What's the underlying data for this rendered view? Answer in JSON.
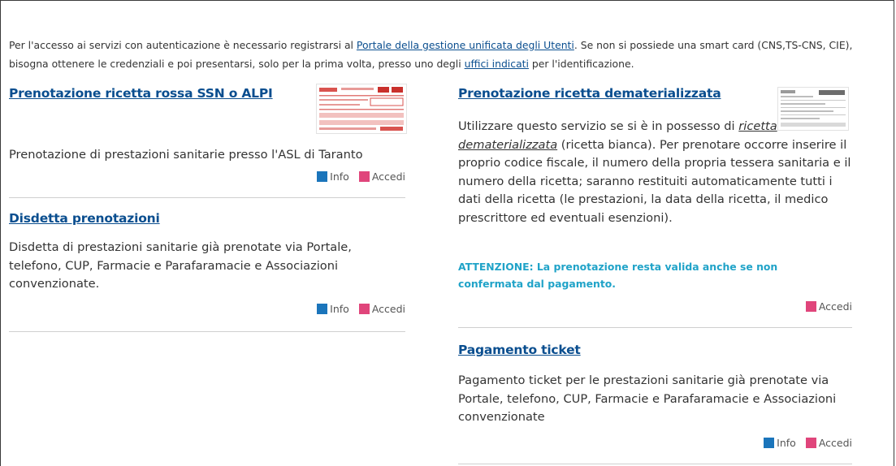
{
  "intro": {
    "text_1": "Per l'accesso ai servizi con autenticazione è necessario registrarsi al ",
    "link_portale": "Portale della gestione unificata degli Utenti",
    "text_2": ". Se non si possiede una smart card (CNS,TS-CNS, CIE), bisogna ottenere le credenziali e poi presentarsi, solo per la prima volta, presso uno degli ",
    "link_uffici": "uffici indicati",
    "text_3": " per l'identificazione."
  },
  "cards": {
    "ricetta_rossa": {
      "title": "Prenotazione ricetta rossa SSN o ALPI",
      "desc": "Prenotazione di prestazioni sanitarie presso l'ASL di Taranto",
      "info": "Info",
      "accedi": "Accedi"
    },
    "disdetta": {
      "title": "Disdetta prenotazioni",
      "desc": "Disdetta di prestazioni sanitarie già prenotate via Portale, telefono, CUP, Farmacie e Parafaramacie e Associazioni convenzionate.",
      "info": "Info",
      "accedi": "Accedi"
    },
    "dematerializzata": {
      "title": "Prenotazione ricetta dematerializzata",
      "desc_1": "Utilizzare questo servizio se si è in possesso di ",
      "desc_link": "ricetta dematerializzata",
      "desc_2": " (ricetta bianca). Per prenotare occorre inserire il proprio codice fiscale, il numero della propria tessera sanitaria e il numero della ricetta; saranno restituiti automaticamente tutti i dati della ricetta (le prestazioni, la data della ricetta, il medico prescrittore ed eventuali esenzioni).",
      "attention": "ATTENZIONE: La prenotazione resta valida anche se non confermata dal pagamento.",
      "accedi": "Accedi"
    },
    "ticket": {
      "title": "Pagamento ticket",
      "desc": "Pagamento ticket per le prestazioni sanitarie già prenotate via Portale, telefono, CUP, Farmacie e Parafaramacie e Associazioni convenzionate",
      "info": "Info",
      "accedi": "Accedi"
    }
  },
  "colors": {
    "link": "#0a4e8f",
    "info_square": "#1b75bb",
    "accedi_square": "#e0457b",
    "attention": "#20a3c8"
  },
  "icons": {
    "ricetta_rossa_thumb": "red-prescription-thumbnail",
    "dematerializzata_thumb": "white-prescription-thumbnail"
  }
}
